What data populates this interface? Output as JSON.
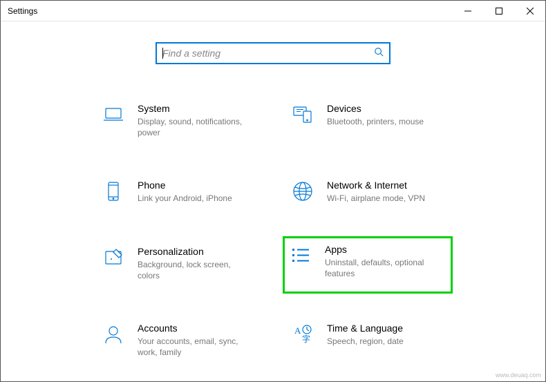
{
  "window": {
    "title": "Settings"
  },
  "search": {
    "placeholder": "Find a setting"
  },
  "categories": [
    {
      "id": "system",
      "title": "System",
      "desc": "Display, sound, notifications, power",
      "icon": "laptop-icon",
      "highlighted": false
    },
    {
      "id": "devices",
      "title": "Devices",
      "desc": "Bluetooth, printers, mouse",
      "icon": "devices-icon",
      "highlighted": false
    },
    {
      "id": "phone",
      "title": "Phone",
      "desc": "Link your Android, iPhone",
      "icon": "phone-icon",
      "highlighted": false
    },
    {
      "id": "network",
      "title": "Network & Internet",
      "desc": "Wi-Fi, airplane mode, VPN",
      "icon": "globe-icon",
      "highlighted": false
    },
    {
      "id": "personalization",
      "title": "Personalization",
      "desc": "Background, lock screen, colors",
      "icon": "paint-icon",
      "highlighted": false
    },
    {
      "id": "apps",
      "title": "Apps",
      "desc": "Uninstall, defaults, optional features",
      "icon": "apps-icon",
      "highlighted": true
    },
    {
      "id": "accounts",
      "title": "Accounts",
      "desc": "Your accounts, email, sync, work, family",
      "icon": "account-icon",
      "highlighted": false
    },
    {
      "id": "time",
      "title": "Time & Language",
      "desc": "Speech, region, date",
      "icon": "time-language-icon",
      "highlighted": false
    }
  ],
  "watermark": "www.deuaq.com",
  "colors": {
    "accent": "#0078d7",
    "highlight": "#00d000"
  }
}
